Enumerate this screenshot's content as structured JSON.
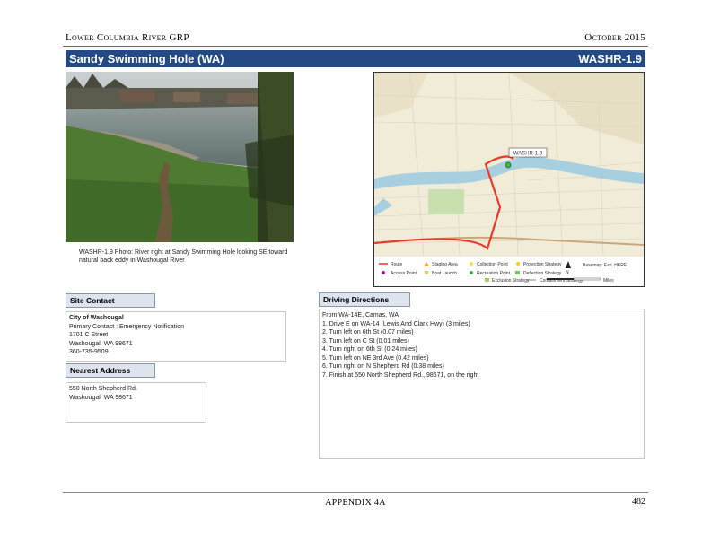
{
  "header": {
    "left": "Lower Columbia River GRP",
    "right": "October 2015"
  },
  "banner": {
    "title": "Sandy Swimming Hole (WA)",
    "code": "WASHR-1.9"
  },
  "photo": {
    "caption": "WASHR-1.9 Photo: River right at Sandy Swimming Hole looking SE toward natural back eddy in Washougal River"
  },
  "map": {
    "site_label": "WASHR-1.9",
    "legend": [
      "Route",
      "Access Point",
      "Staging Area",
      "Boat Launch",
      "Collection Point",
      "Recreation Point",
      "Protection Strategy",
      "Deflection Strategy",
      "Exclusion Strategy",
      "Containment Strategy"
    ],
    "north_label": "N",
    "scale_label": "Miles",
    "source": "Basemap: Esri, HERE"
  },
  "site_contact": {
    "label": "Site Contact",
    "org": "City of Washougal",
    "line1": "Primary Contact : Emergency Notification",
    "line2": "1701 C Street",
    "line3": "Washougal, WA  98671",
    "line4": "360-735-9509"
  },
  "nearest_address": {
    "label": "Nearest Address",
    "line1": "550 North Shepherd Rd.",
    "line2": "Washougal, WA  98671"
  },
  "driving": {
    "label": "Driving Directions",
    "steps": [
      "From WA-14E, Camas, WA",
      "1. Drive E on WA-14 (Lewis And Clark Hwy) (3 miles)",
      "2. Turn left on 6th St (0.07 miles)",
      "3. Turn left on C St (0.01 miles)",
      "4. Turn right on 6th St (0.24 miles)",
      "5. Turn left on NE 3rd Ave (0.42 miles)",
      "6. Turn right on N Shepherd Rd (0.38 miles)",
      "7. Finish at 550 North Shepherd Rd., 98671, on the right"
    ]
  },
  "footer": {
    "center": "APPENDIX 4A",
    "page": "482"
  }
}
